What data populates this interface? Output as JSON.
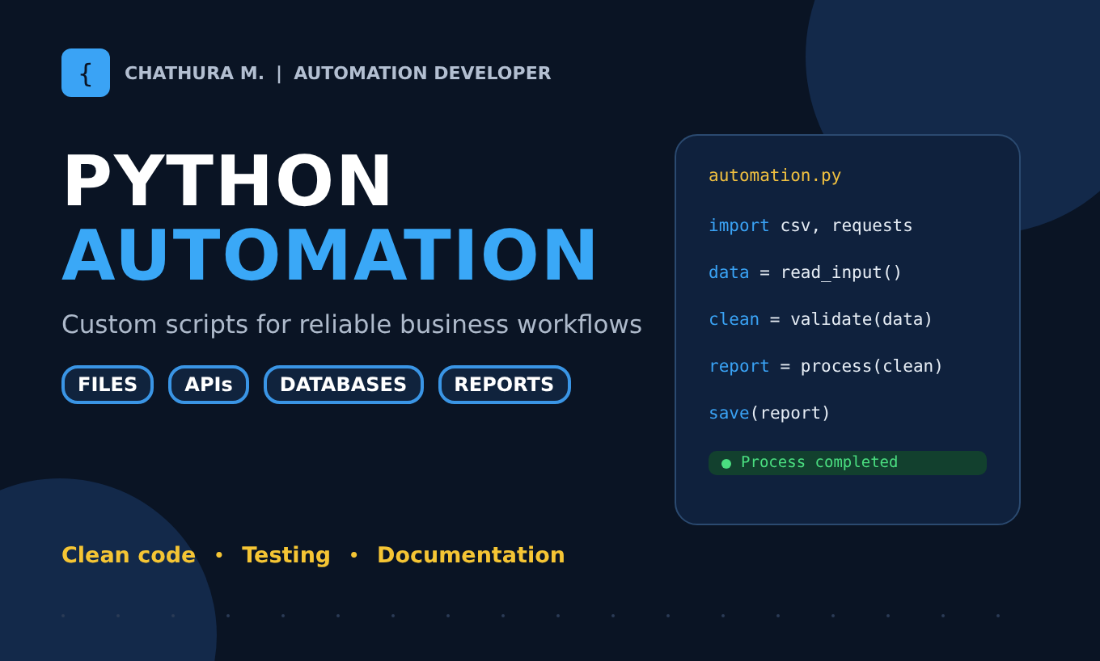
{
  "header": {
    "logo_glyph": "{",
    "name": "CHATHURA M.",
    "divider": "|",
    "role": "AUTOMATION DEVELOPER"
  },
  "title": {
    "line_1": "PYTHON",
    "line_2": "AUTOMATION"
  },
  "subtitle": "Custom scripts for reliable business workflows",
  "tags": [
    "FILES",
    "APIs",
    "DATABASES",
    "REPORTS"
  ],
  "features": [
    {
      "kind": "label",
      "text": "Clean code"
    },
    {
      "kind": "separator",
      "text": "•"
    },
    {
      "kind": "label",
      "text": "Testing"
    },
    {
      "kind": "separator",
      "text": "•"
    },
    {
      "kind": "label",
      "text": "Documentation"
    }
  ],
  "code_card": {
    "filename": "automation.py",
    "lines": [
      [
        {
          "kind": "keyword",
          "text": "import"
        },
        {
          "kind": "plain",
          "text": " csv, requests"
        }
      ],
      [
        {
          "kind": "keyword",
          "text": "data"
        },
        {
          "kind": "plain",
          "text": " = read_input()"
        }
      ],
      [
        {
          "kind": "keyword",
          "text": "clean"
        },
        {
          "kind": "plain",
          "text": " = validate(data)"
        }
      ],
      [
        {
          "kind": "keyword",
          "text": "report"
        },
        {
          "kind": "plain",
          "text": " = process(clean)"
        }
      ],
      [
        {
          "kind": "keyword",
          "text": "save"
        },
        {
          "kind": "plain",
          "text": "(report)"
        }
      ]
    ],
    "status": {
      "text": "Process completed",
      "color": "#4ade80"
    }
  }
}
